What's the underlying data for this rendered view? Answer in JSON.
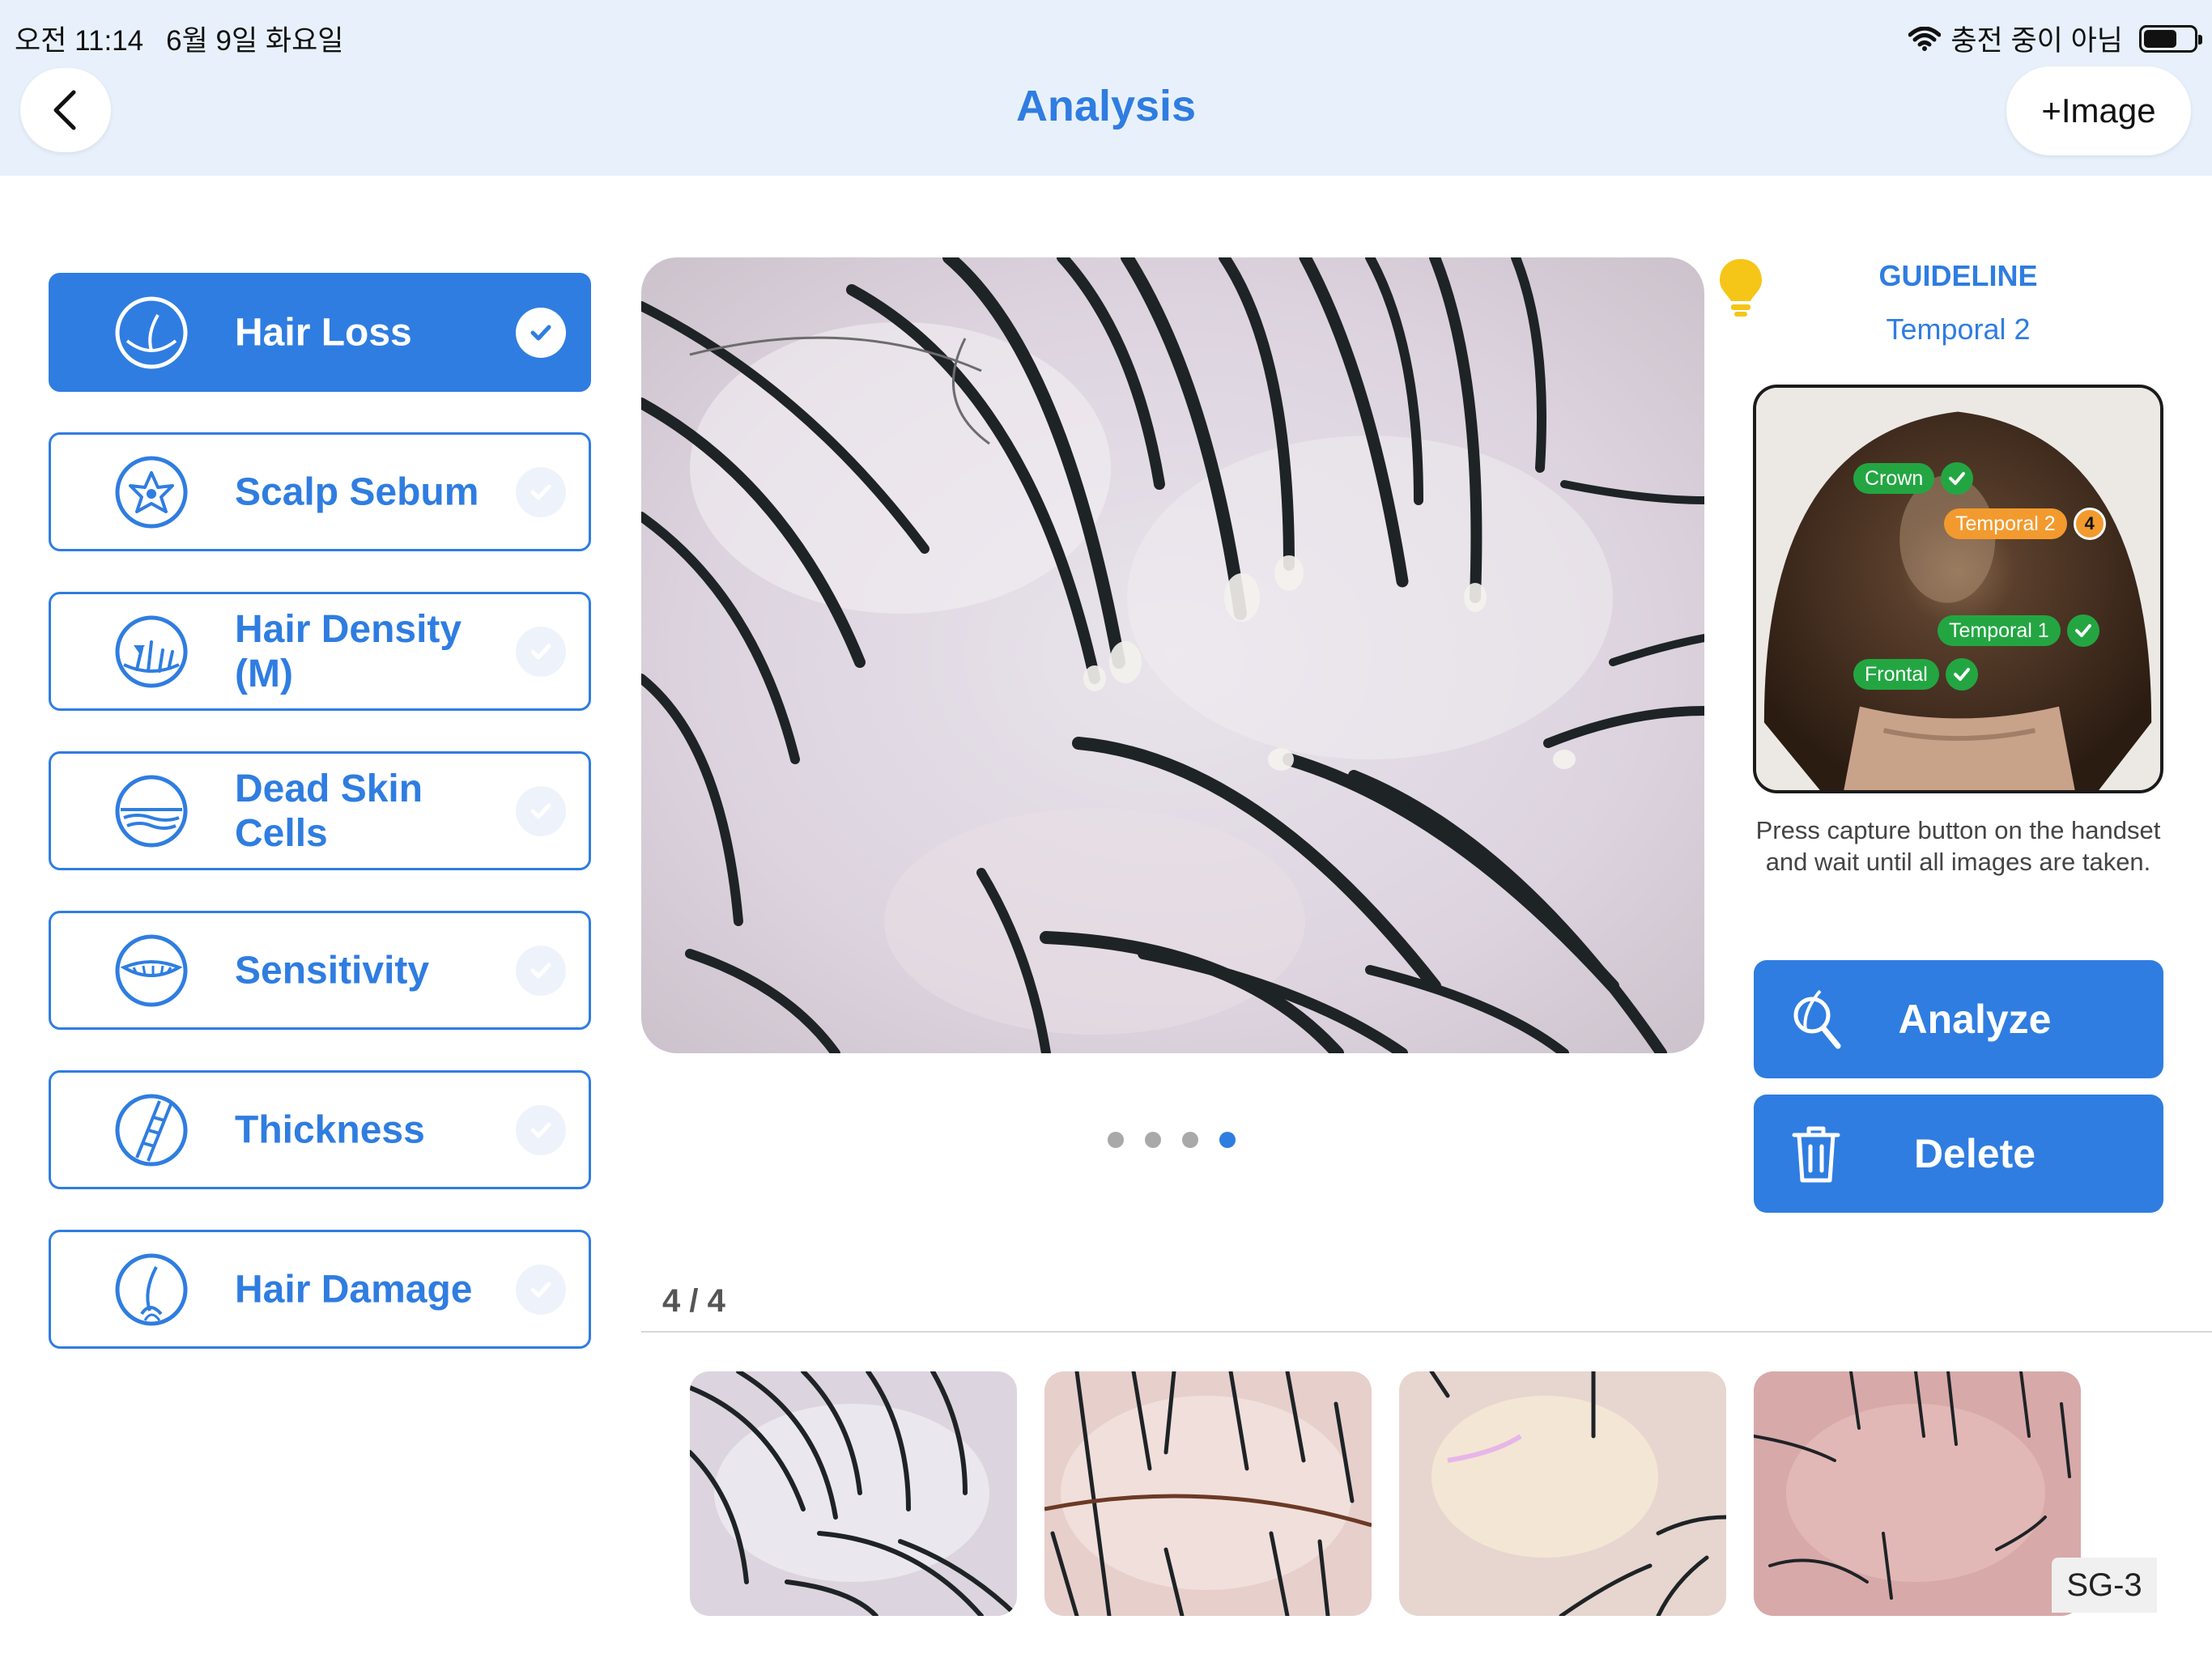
{
  "status_bar": {
    "time": "오전 11:14",
    "date": "6월 9일 화요일",
    "charging": "충전 중이 아님"
  },
  "header": {
    "title": "Analysis",
    "add_image_label": "+Image"
  },
  "menu": {
    "items": [
      {
        "label": "Hair Loss",
        "icon": "hair-loss-icon",
        "active": true
      },
      {
        "label": "Scalp Sebum",
        "icon": "scalp-sebum-icon",
        "active": false
      },
      {
        "label": "Hair Density\n(M)",
        "icon": "hair-density-icon",
        "active": false
      },
      {
        "label": "Dead Skin\nCells",
        "icon": "dead-skin-cells-icon",
        "active": false
      },
      {
        "label": "Sensitivity",
        "icon": "sensitivity-icon",
        "active": false
      },
      {
        "label": "Thickness",
        "icon": "thickness-icon",
        "active": false
      },
      {
        "label": "Hair Damage",
        "icon": "hair-damage-icon",
        "active": false
      }
    ]
  },
  "main_image": {
    "page_count": 4,
    "active_page": 4
  },
  "gallery": {
    "counter": "4 / 4",
    "device_label": "SG-3"
  },
  "guideline": {
    "title": "GUIDELINE",
    "subtitle": "Temporal 2",
    "spots": {
      "crown": "Crown",
      "temporal2": "Temporal 2",
      "temporal2_badge": "4",
      "temporal1": "Temporal 1",
      "frontal": "Frontal"
    },
    "instruction": "Press capture button on the handset and wait until all images are taken."
  },
  "actions": {
    "analyze": "Analyze",
    "delete": "Delete"
  },
  "colors": {
    "accent": "#2f7de1",
    "header_bg": "#e8f1fb",
    "done_green": "#23a642",
    "current_orange": "#f29a2e"
  }
}
